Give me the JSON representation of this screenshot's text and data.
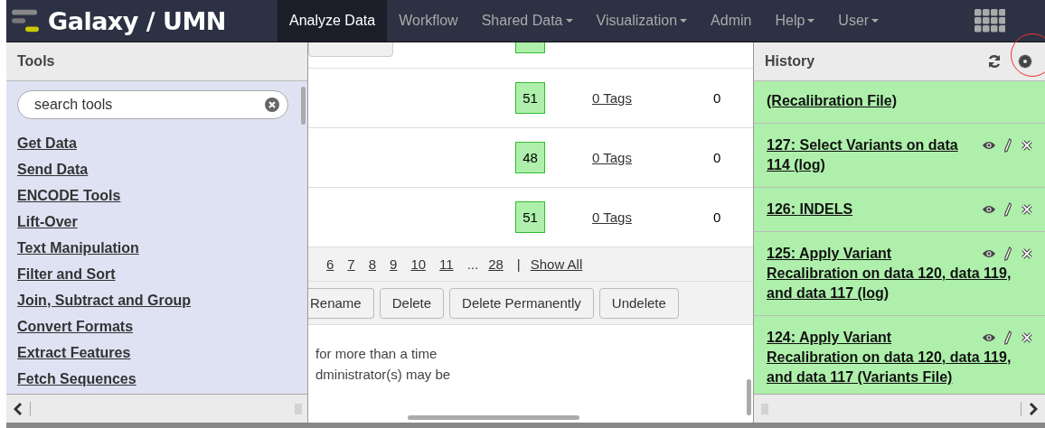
{
  "brand": {
    "title": "Galaxy / UMN"
  },
  "nav": [
    {
      "label": "Analyze Data",
      "selected": true,
      "dropdown": false
    },
    {
      "label": "Workflow",
      "selected": false,
      "dropdown": false
    },
    {
      "label": "Shared Data",
      "selected": false,
      "dropdown": true
    },
    {
      "label": "Visualization",
      "selected": false,
      "dropdown": true
    },
    {
      "label": "Admin",
      "selected": false,
      "dropdown": false
    },
    {
      "label": "Help",
      "selected": false,
      "dropdown": true
    },
    {
      "label": "User",
      "selected": false,
      "dropdown": true
    }
  ],
  "tools": {
    "title": "Tools",
    "search": {
      "placeholder": "search tools"
    },
    "items": [
      "Get Data",
      "Send Data",
      "ENCODE Tools",
      "Lift-Over",
      "Text Manipulation",
      "Filter and Sort",
      "Join, Subtract and Group",
      "Convert Formats",
      "Extract Features",
      "Fetch Sequences"
    ]
  },
  "center": {
    "rows": [
      {
        "count": "51",
        "tags": "0 Tags",
        "size": "0"
      },
      {
        "count": "48",
        "tags": "0 Tags",
        "size": "0"
      },
      {
        "count": "51",
        "tags": "0 Tags",
        "size": "0"
      }
    ],
    "pager": {
      "pages": [
        "6",
        "7",
        "8",
        "9",
        "10",
        "11"
      ],
      "ellipsis": "...",
      "last": "28",
      "separator": "|",
      "show_all": "Show All"
    },
    "buttons": [
      "Rename",
      "Delete",
      "Delete Permanently",
      "Undelete"
    ],
    "message": [
      "for more than a time",
      "dministrator(s) may be"
    ]
  },
  "history": {
    "title": "History",
    "items": [
      {
        "title": "(Recalibration File)",
        "icons": false
      },
      {
        "title": "127: Select Variants on data 114 (log)",
        "icons": true
      },
      {
        "title": "126: INDELS",
        "icons": true
      },
      {
        "title": "125: Apply Variant Recalibration on data 120, data 119, and data 117 (log)",
        "icons": true
      },
      {
        "title": "124: Apply Variant Recalibration on data 120, data 119, and data 117 (Variants File)",
        "icons": true
      }
    ]
  }
}
